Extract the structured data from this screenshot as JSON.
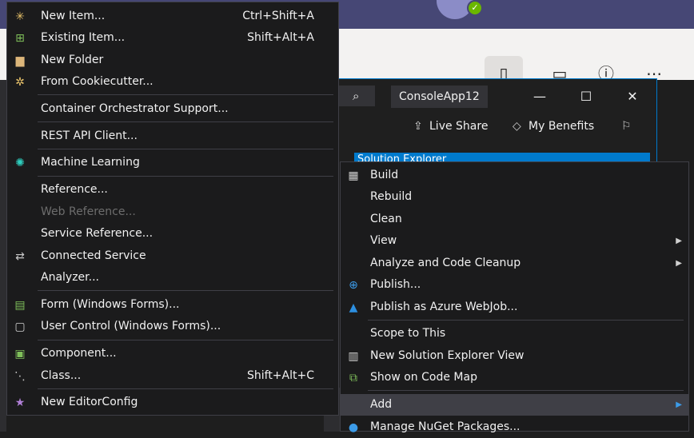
{
  "vs": {
    "project_name": "ConsoleApp12",
    "live_share": "Live Share",
    "my_benefits": "My Benefits",
    "solution_explorer": "Solution Explorer"
  },
  "add_menu": {
    "new_item": {
      "label": "New Item...",
      "shortcut": "Ctrl+Shift+A"
    },
    "existing_item": {
      "label": "Existing Item...",
      "shortcut": "Shift+Alt+A"
    },
    "new_folder": {
      "label": "New Folder"
    },
    "from_cookiecutter": {
      "label": "From Cookiecutter..."
    },
    "container_orchestrator": {
      "label": "Container Orchestrator Support..."
    },
    "rest_api_client": {
      "label": "REST API Client..."
    },
    "machine_learning": {
      "label": "Machine Learning"
    },
    "reference": {
      "label": "Reference..."
    },
    "web_reference": {
      "label": "Web Reference...",
      "disabled": true
    },
    "service_reference": {
      "label": "Service Reference..."
    },
    "connected_service": {
      "label": "Connected Service"
    },
    "analyzer": {
      "label": "Analyzer..."
    },
    "form": {
      "label": "Form (Windows Forms)..."
    },
    "user_control": {
      "label": "User Control (Windows Forms)..."
    },
    "component": {
      "label": "Component..."
    },
    "class": {
      "label": "Class...",
      "shortcut": "Shift+Alt+C"
    },
    "new_editorconfig": {
      "label": "New EditorConfig"
    }
  },
  "project_menu": {
    "build": "Build",
    "rebuild": "Rebuild",
    "clean": "Clean",
    "view": "View",
    "analyze": "Analyze and Code Cleanup",
    "publish": "Publish...",
    "publish_azure": "Publish as Azure WebJob...",
    "scope": "Scope to This",
    "new_se_view": "New Solution Explorer View",
    "code_map": "Show on Code Map",
    "add": "Add",
    "nuget": "Manage NuGet Packages..."
  },
  "colors": {
    "menu_bg": "#1b1b1c",
    "menu_border": "#3f3f46",
    "accent": "#007acc",
    "selected_bg": "#3f3f46",
    "disabled_text": "#6d6d6d",
    "teams_header": "#464775"
  }
}
